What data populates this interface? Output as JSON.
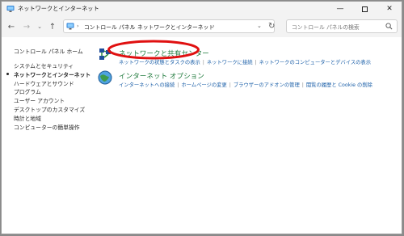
{
  "window": {
    "title": "ネットワークとインターネット",
    "controls": {
      "minimize": "—",
      "close": "✕"
    }
  },
  "nav": {
    "back": "←",
    "forward": "→",
    "recent": "⌄",
    "up": "↑",
    "breadcrumbs": [
      "コントロール パネル",
      "ネットワークとインターネット"
    ],
    "separator": "›",
    "refresh": "↻"
  },
  "search": {
    "placeholder": "コントロール パネルの検索"
  },
  "sidebar": {
    "home": "コントロール パネル ホーム",
    "items": [
      {
        "label": "システムとセキュリティ"
      },
      {
        "label": "ネットワークとインターネット",
        "active": true
      },
      {
        "label": "ハードウェアとサウンド"
      },
      {
        "label": "プログラム"
      },
      {
        "label": "ユーザー アカウント"
      },
      {
        "label": "デスクトップのカスタマイズ"
      },
      {
        "label": "時計と地域"
      },
      {
        "label": "コンピューターの簡単操作"
      }
    ]
  },
  "categories": [
    {
      "title": "ネットワークと共有センター",
      "icon": "network-sharing-center-icon",
      "links": [
        "ネットワークの状態とタスクの表示",
        "ネットワークに接続",
        "ネットワークのコンピューターとデバイスの表示"
      ]
    },
    {
      "title": "インターネット オプション",
      "icon": "internet-options-icon",
      "links": [
        "インターネットへの接続",
        "ホームページの変更",
        "ブラウザーのアドオンの管理",
        "閲覧の履歴と Cookie の削除"
      ]
    }
  ],
  "colors": {
    "category_title": "#1f7a3c",
    "link": "#1b5fa8",
    "highlight_annotation": "#e01010"
  }
}
